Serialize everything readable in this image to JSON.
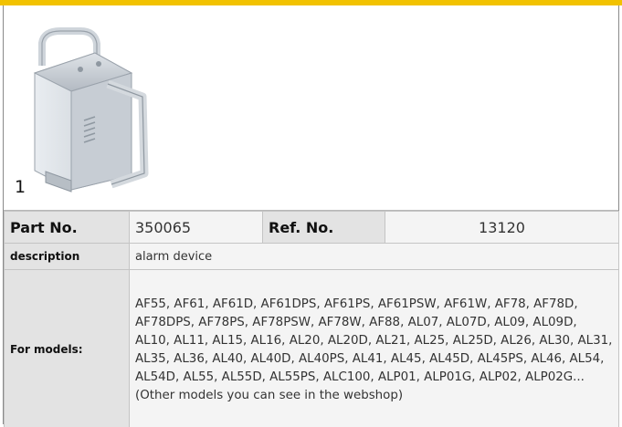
{
  "image": {
    "number": "1",
    "icon": "product-photo-icon"
  },
  "specs": {
    "part_label": "Part No.",
    "part_value": "350065",
    "ref_label": "Ref. No.",
    "ref_value": "13120",
    "description_label": "description",
    "description_value": "alarm device",
    "models_label": "For models:",
    "models_value": "AF55, AF61, AF61D, AF61DPS, AF61PS, AF61PSW, AF61W, AF78, AF78D, AF78DPS, AF78PS, AF78PSW, AF78W, AF88, AL07, AL07D, AL09, AL09D, AL10, AL11, AL15, AL16, AL20, AL20D, AL21, AL25, AL25D, AL26, AL30, AL31, AL35, AL36, AL40, AL40D, AL40PS, AL41, AL45, AL45D, AL45PS, AL46, AL54, AL54D, AL55, AL55D, AL55PS, ALC100, ALP01, ALP01G, ALP02, ALP02G...(Other models you can see in the webshop)"
  },
  "colors": {
    "accent": "#f2c200",
    "label_bg": "#e3e3e3",
    "value_bg": "#f4f4f4"
  }
}
